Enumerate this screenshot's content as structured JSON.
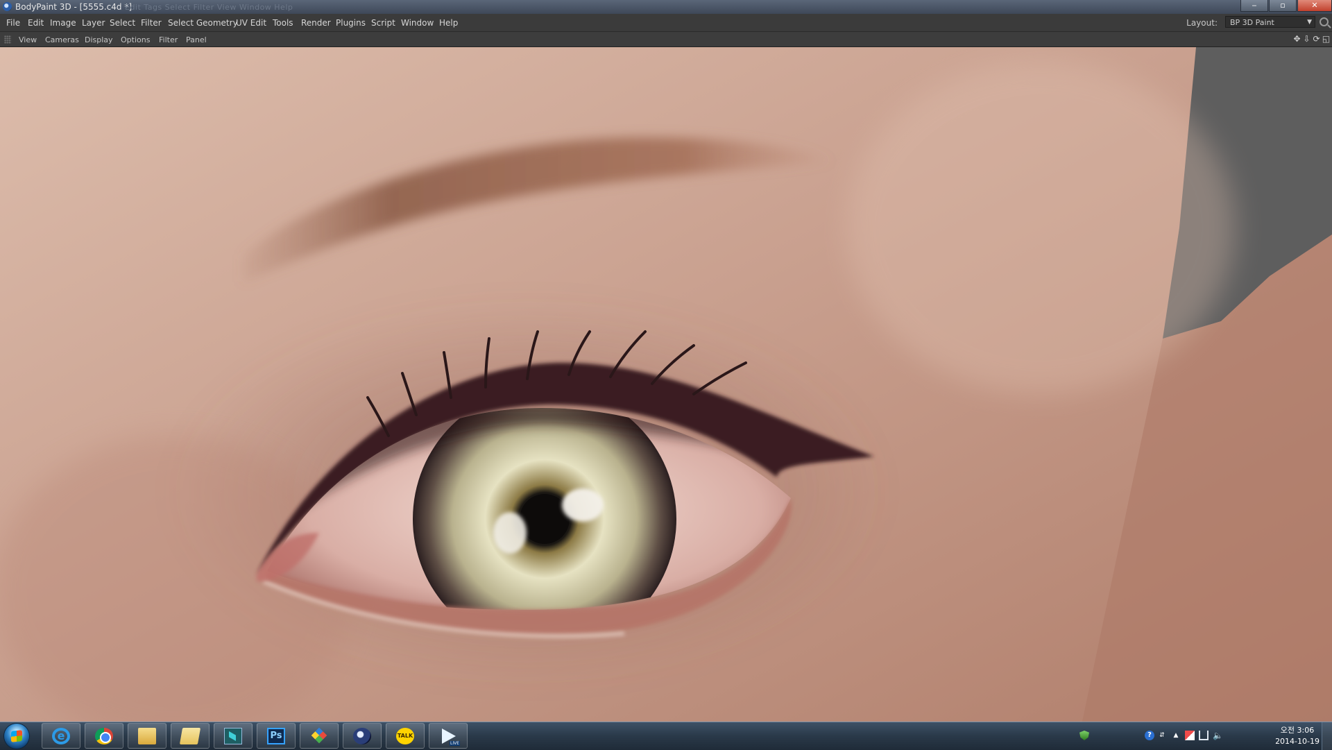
{
  "window": {
    "title": "BodyPaint 3D - [5555.c4d *]",
    "ghost_menu": "Edit   Tags   Select   Filter   View   Window   Help",
    "controls": {
      "minimize": "‒",
      "maximize": "▫",
      "close": "✕"
    }
  },
  "menubar": {
    "items": [
      "File",
      "Edit",
      "Image",
      "Layer",
      "Select",
      "Filter",
      "Select Geometry",
      "UV Edit",
      "Tools",
      "Render",
      "Plugins",
      "Script",
      "Window",
      "Help"
    ],
    "layout_label": "Layout:",
    "layout_value": "BP 3D Paint"
  },
  "viewbar": {
    "items": [
      "View",
      "Cameras",
      "Display",
      "Options",
      "Filter",
      "Panel"
    ],
    "controls": [
      "✥",
      "⇩",
      "⟳",
      "◱"
    ]
  },
  "colors": {
    "skin_light": "#dcb5a0",
    "skin_mid": "#c69580",
    "iris": "#cfc7a0",
    "background_gray": "#5e5e5e"
  },
  "taskbar": {
    "apps": [
      {
        "name": "internet-explorer",
        "glyph": "e"
      },
      {
        "name": "chrome",
        "glyph": ""
      },
      {
        "name": "file-explorer",
        "glyph": ""
      },
      {
        "name": "folder",
        "glyph": ""
      },
      {
        "name": "maya",
        "glyph": ""
      },
      {
        "name": "photoshop",
        "glyph": "Ps"
      },
      {
        "name": "app-diamond",
        "glyph": ""
      },
      {
        "name": "cinema4d",
        "glyph": ""
      },
      {
        "name": "kakaotalk",
        "glyph": "TALK"
      },
      {
        "name": "live-player",
        "glyph": "LIVE"
      }
    ],
    "tray": {
      "help": "?",
      "time": "오전 3:06",
      "date": "2014-10-19"
    }
  }
}
